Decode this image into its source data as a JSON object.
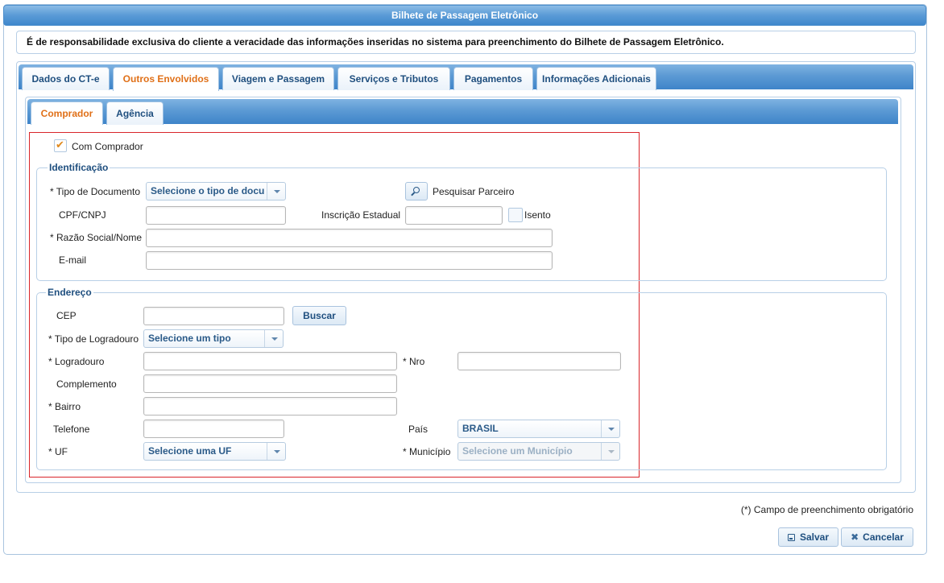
{
  "window": {
    "title": "Bilhete de Passagem Eletrônico"
  },
  "notice": "É de responsabilidade exclusiva do cliente a veracidade das informações inseridas no sistema para preenchimento do Bilhete de Passagem Eletrônico.",
  "tabs": [
    {
      "label": "Dados do CT-e"
    },
    {
      "label": "Outros Envolvidos"
    },
    {
      "label": "Viagem e Passagem"
    },
    {
      "label": "Serviços e Tributos"
    },
    {
      "label": "Pagamentos"
    },
    {
      "label": "Informações Adicionais"
    }
  ],
  "active_tab": "Outros Envolvidos",
  "subtabs": [
    {
      "label": "Comprador"
    },
    {
      "label": "Agência"
    }
  ],
  "active_subtab": "Comprador",
  "form": {
    "com_comprador": {
      "label": "Com Comprador",
      "checked": true
    },
    "identificacao": {
      "legend": "Identificação",
      "tipo_documento": {
        "label": "* Tipo de Documento",
        "value": "Selecione o tipo de docu"
      },
      "pesquisar_parceiro": "Pesquisar Parceiro",
      "cpf_cnpj": {
        "label": "CPF/CNPJ",
        "value": ""
      },
      "inscricao_estadual": {
        "label": "Inscrição Estadual",
        "value": ""
      },
      "isento": {
        "label": "Isento",
        "checked": false
      },
      "razao_social": {
        "label": "* Razão Social/Nome",
        "value": ""
      },
      "email": {
        "label": "E-mail",
        "value": ""
      }
    },
    "endereco": {
      "legend": "Endereço",
      "cep": {
        "label": "CEP",
        "value": ""
      },
      "buscar": "Buscar",
      "tipo_logradouro": {
        "label": "* Tipo de Logradouro",
        "value": "Selecione um tipo"
      },
      "logradouro": {
        "label": "* Logradouro",
        "value": ""
      },
      "nro": {
        "label": "* Nro",
        "value": ""
      },
      "complemento": {
        "label": "Complemento",
        "value": ""
      },
      "bairro": {
        "label": "* Bairro",
        "value": ""
      },
      "telefone": {
        "label": "Telefone",
        "value": ""
      },
      "pais": {
        "label": "País",
        "value": "BRASIL"
      },
      "uf": {
        "label": "* UF",
        "value": "Selecione uma UF"
      },
      "municipio": {
        "label": "* Município",
        "value": "Selecione um Município"
      }
    }
  },
  "footer": {
    "required_note": "(*) Campo de preenchimento obrigatório",
    "save": "Salvar",
    "cancel": "Cancelar"
  },
  "colors": {
    "accent": "#e07018",
    "tab_text": "#1f4f7f",
    "header": "#5a9bd6",
    "highlight_border": "#d9262b"
  }
}
